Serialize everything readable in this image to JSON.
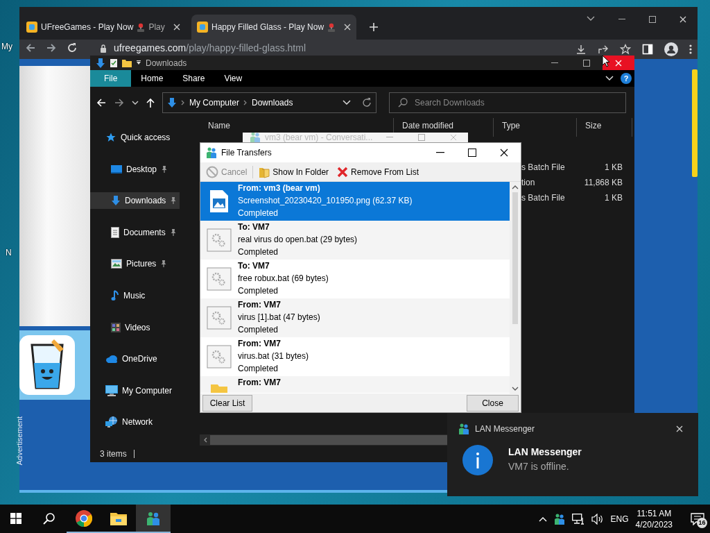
{
  "desktop": {
    "icon_labels": [
      "My",
      "N"
    ]
  },
  "browser": {
    "tabs": [
      {
        "title": "UFreeGames - Play Now",
        "title_overflow": "Play",
        "selected": false
      },
      {
        "title": "Happy Filled Glass - Play Now",
        "selected": true
      }
    ],
    "url_host": "ufreegames.com",
    "url_path": "/play/happy-filled-glass.html",
    "ad_label": "Advertisement"
  },
  "explorer": {
    "title": "Downloads",
    "ribbon_tabs": [
      {
        "label": "File",
        "selected": true
      },
      {
        "label": "Home",
        "selected": false
      },
      {
        "label": "Share",
        "selected": false
      },
      {
        "label": "View",
        "selected": false
      }
    ],
    "help_glyph": "?",
    "breadcrumb": [
      "My Computer",
      "Downloads"
    ],
    "search": {
      "placeholder": "Search Downloads"
    },
    "columns": [
      "Name",
      "Date modified",
      "Type",
      "Size"
    ],
    "nav": [
      {
        "label": "Quick access",
        "kind": "star",
        "pinned": false,
        "selected": false,
        "children": [
          {
            "label": "Desktop",
            "kind": "desktop",
            "pinned": true,
            "selected": false
          },
          {
            "label": "Downloads",
            "kind": "download",
            "pinned": true,
            "selected": true
          },
          {
            "label": "Documents",
            "kind": "document",
            "pinned": true,
            "selected": false
          },
          {
            "label": "Pictures",
            "kind": "picture",
            "pinned": true,
            "selected": false
          },
          {
            "label": "Music",
            "kind": "music",
            "pinned": false,
            "selected": false
          },
          {
            "label": "Videos",
            "kind": "video",
            "pinned": false,
            "selected": false
          }
        ]
      },
      {
        "label": "OneDrive",
        "kind": "cloud",
        "pinned": false,
        "selected": false
      },
      {
        "label": "My Computer",
        "kind": "computer",
        "pinned": false,
        "selected": false
      },
      {
        "label": "Network",
        "kind": "network",
        "pinned": false,
        "selected": false
      }
    ],
    "rows": [
      {
        "type": "s Batch File",
        "size": "1 KB"
      },
      {
        "type": "tion",
        "size": "11,868 KB"
      },
      {
        "type": "s Batch File",
        "size": "1 KB"
      }
    ],
    "status": "3 items"
  },
  "conversation_window": {
    "title": "vm3 (bear vm) - Conversati..."
  },
  "file_transfers": {
    "title": "File Transfers",
    "toolbar": [
      {
        "label": "Cancel",
        "kind": "cancel",
        "disabled": true
      },
      {
        "label": "Show In Folder",
        "kind": "folder",
        "disabled": false
      },
      {
        "label": "Remove From List",
        "kind": "remove",
        "disabled": false
      }
    ],
    "items": [
      {
        "header": "From: vm3 (bear vm)",
        "file": "Screenshot_20230420_101950.png (62.37 KB)",
        "status": "Completed",
        "kind": "image",
        "selected": true
      },
      {
        "header": "To: VM7",
        "file": "real virus do open.bat (29 bytes)",
        "status": "Completed",
        "kind": "file",
        "selected": false
      },
      {
        "header": "To: VM7",
        "file": "free robux.bat (69 bytes)",
        "status": "Completed",
        "kind": "file",
        "selected": false
      },
      {
        "header": "From: VM7",
        "file": "virus [1].bat (47 bytes)",
        "status": "Completed",
        "kind": "file",
        "selected": false
      },
      {
        "header": "From: VM7",
        "file": "virus.bat (31 bytes)",
        "status": "Completed",
        "kind": "file",
        "selected": false
      },
      {
        "header": "From: VM7",
        "kind": "folder",
        "selected": false
      }
    ],
    "buttons": [
      "Clear List",
      "Close"
    ]
  },
  "notification": {
    "app": "LAN Messenger",
    "title": "LAN Messenger",
    "message": "VM7 is offline."
  },
  "taskbar": {
    "apps": [
      {
        "kind": "chrome",
        "running": true,
        "active": false
      },
      {
        "kind": "explorer",
        "running": true,
        "active": false
      },
      {
        "kind": "messenger",
        "running": true,
        "active": true
      }
    ],
    "language": "ENG",
    "time": "11:51 AM",
    "date": "4/20/2023",
    "notification_count": "16"
  }
}
